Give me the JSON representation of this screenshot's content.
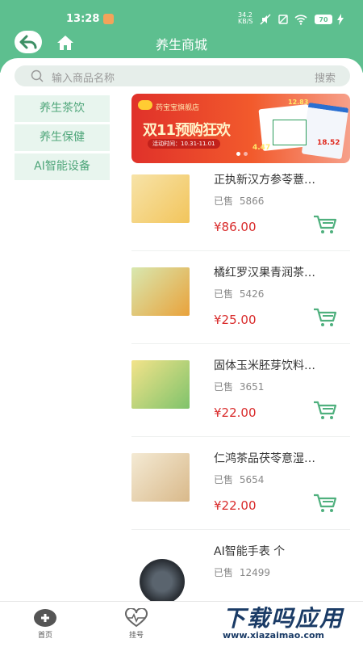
{
  "status_bar": {
    "time": "13:28",
    "network_speed": "34.2",
    "network_unit": "KB/S",
    "battery": "70"
  },
  "nav": {
    "title": "养生商城"
  },
  "search": {
    "placeholder": "输入商品名称",
    "button": "搜索"
  },
  "categories": [
    {
      "label": "养生茶饮"
    },
    {
      "label": "养生保健"
    },
    {
      "label": "AI智能设备"
    }
  ],
  "banner": {
    "store": "药宝宝旗舰店",
    "headline": "双11预购狂欢",
    "date": "活动时间：10.31-11.01",
    "price_1": "4.47",
    "price_2": "18.52",
    "price_3": "12.83"
  },
  "products": [
    {
      "name": "正执新汉方参苓薏…",
      "sold_label": "已售",
      "sold": "5866",
      "price": "¥86.00",
      "thumb_color": "#f2c55c"
    },
    {
      "name": "橘红罗汉果青润茶…",
      "sold_label": "已售",
      "sold": "5426",
      "price": "¥25.00",
      "thumb_color": "#e9a23b"
    },
    {
      "name": "固体玉米胚芽饮料…",
      "sold_label": "已售",
      "sold": "3651",
      "price": "¥22.00",
      "thumb_color": "#7fc36b"
    },
    {
      "name": "仁鸿茶品茯苓意湿…",
      "sold_label": "已售",
      "sold": "5654",
      "price": "¥22.00",
      "thumb_color": "#d9b98a"
    },
    {
      "name": "AI智能手表 个",
      "sold_label": "已售",
      "sold": "12499",
      "price": "",
      "thumb_color": "#3a3f45"
    }
  ],
  "tabbar": {
    "home": "首页",
    "register": "挂号"
  },
  "watermark": {
    "title": "下载吗应用",
    "url": "www.xiazaimao.com"
  },
  "colors": {
    "primary": "#5dbf8f",
    "price": "#d92b2b",
    "category_bg": "#e8f5ee"
  }
}
